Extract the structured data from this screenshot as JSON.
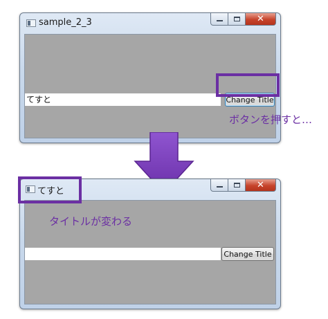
{
  "before_window": {
    "title": "sample_2_3",
    "textbox_value": "てすと",
    "button_label": "Change Title"
  },
  "before_callout": "ボタンを押すと…",
  "after_window": {
    "title": "てすと",
    "textbox_value": "",
    "button_label": "Change Title"
  },
  "after_callout": "タイトルが変わる",
  "colors": {
    "highlight": "#6b2fa3",
    "client_background": "#a6a6a6",
    "arrow": "#7b3fbf"
  }
}
